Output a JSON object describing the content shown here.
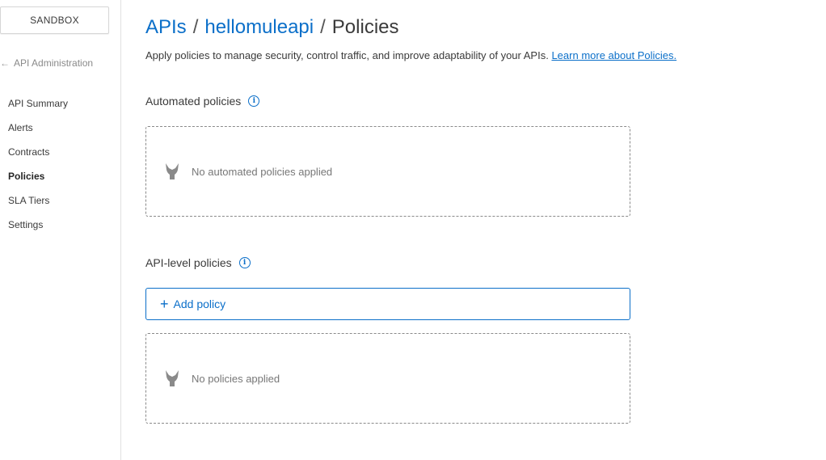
{
  "sidebar": {
    "environment_label": "SANDBOX",
    "back_label": "API Administration",
    "items": [
      {
        "label": "API Summary",
        "active": false
      },
      {
        "label": "Alerts",
        "active": false
      },
      {
        "label": "Contracts",
        "active": false
      },
      {
        "label": "Policies",
        "active": true
      },
      {
        "label": "SLA Tiers",
        "active": false
      },
      {
        "label": "Settings",
        "active": false
      }
    ]
  },
  "header": {
    "breadcrumb": {
      "root": "APIs",
      "api": "hellomuleapi",
      "current": "Policies",
      "separator": "/"
    },
    "description": "Apply policies to manage security, control traffic, and improve adaptability of your APIs.",
    "learn_more": "Learn more about Policies."
  },
  "automated": {
    "title": "Automated policies",
    "empty_text": "No automated policies applied"
  },
  "api_level": {
    "title": "API-level policies",
    "add_label": "Add policy",
    "empty_text": "No policies applied"
  },
  "colors": {
    "accent": "#0b6fc9",
    "text": "#3a3a3a",
    "muted": "#777777"
  }
}
